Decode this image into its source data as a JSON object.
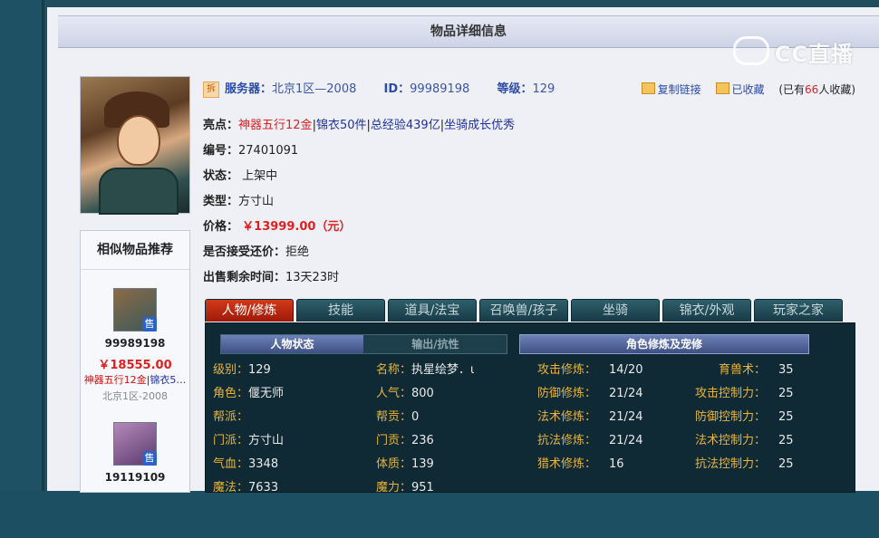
{
  "panel": {
    "title": "物品详细信息"
  },
  "watermark": "CC直播",
  "item": {
    "server_label": "服务器：",
    "server": "北京1区—2008",
    "id_label": "ID：",
    "id": "99989198",
    "level_label": "等级：",
    "level": "129",
    "tag_icon": "拆",
    "copy_link": "复制链接",
    "favorited": "已收藏",
    "fav_prefix": "(已有",
    "fav_count": "66",
    "fav_suffix": "人收藏)",
    "highlights_label": "亮点：",
    "highlight_1": "神器五行12金",
    "highlight_2": "锦衣50件",
    "highlight_3": "总经验439亿",
    "highlight_4": "坐骑成长优秀",
    "sep": "|",
    "serial_label": "编号：",
    "serial": "27401091",
    "status_label": "状态：",
    "status": "上架中",
    "type_label": "类型：",
    "type": "方寸山",
    "price_label": "价格：",
    "price": "￥13999.00（元）",
    "counter_label": "是否接受还价：",
    "counter": "拒绝",
    "remain_label": "出售剩余时间：",
    "remain": "13天23时"
  },
  "similar": {
    "title": "相似物品推荐",
    "items": [
      {
        "badge": "售",
        "id": "99989198",
        "price": "￥18555.00",
        "hl_red": "神器五行12金",
        "hl_blue": "|锦衣5…",
        "server": "北京1区-2008"
      },
      {
        "badge": "售",
        "id": "19119109"
      }
    ]
  },
  "tabs": [
    "人物/修炼",
    "技能",
    "道具/法宝",
    "召唤兽/孩子",
    "坐骑",
    "锦衣/外观",
    "玩家之家"
  ],
  "sub_tabs": {
    "active": "人物状态",
    "inactive": "输出/抗性",
    "cultivation": "角色修炼及宠修"
  },
  "stats": {
    "col1": [
      {
        "k": "级别：",
        "v": "129"
      },
      {
        "k": "角色：",
        "v": "偃无师"
      },
      {
        "k": "帮派：",
        "v": ""
      },
      {
        "k": "门派：",
        "v": "方寸山"
      },
      {
        "k": "气血：",
        "v": "3348"
      },
      {
        "k": "魔法：",
        "v": "7633"
      }
    ],
    "col2": [
      {
        "k": "名称：",
        "v": "执星绘梦．ι"
      },
      {
        "k": "人气：",
        "v": "800"
      },
      {
        "k": "帮贡：",
        "v": "0"
      },
      {
        "k": "门贡：",
        "v": "236"
      },
      {
        "k": "体质：",
        "v": "139"
      },
      {
        "k": "魔力：",
        "v": "951"
      }
    ],
    "col3": [
      {
        "k": "攻击修炼：",
        "v": "14/20"
      },
      {
        "k": "防御修炼：",
        "v": "21/24"
      },
      {
        "k": "法术修炼：",
        "v": "21/24"
      },
      {
        "k": "抗法修炼：",
        "v": "21/24"
      },
      {
        "k": "猎术修炼：",
        "v": "16"
      }
    ],
    "col4": [
      {
        "k": "育兽术：",
        "v": "35"
      },
      {
        "k": "攻击控制力：",
        "v": "25"
      },
      {
        "k": "防御控制力：",
        "v": "25"
      },
      {
        "k": "法术控制力：",
        "v": "25"
      },
      {
        "k": "抗法控制力：",
        "v": "25"
      }
    ]
  }
}
